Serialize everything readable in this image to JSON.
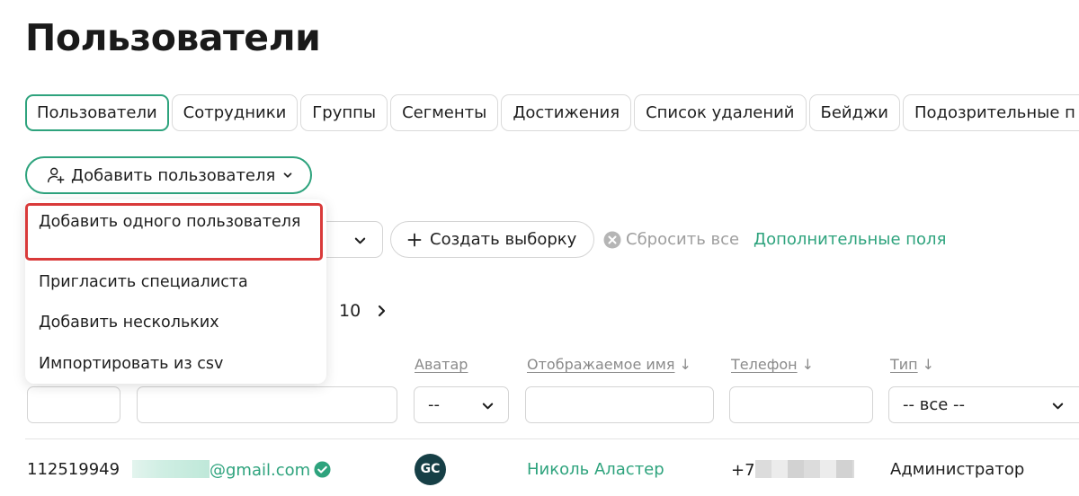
{
  "page": {
    "title": "Пользователи"
  },
  "tabs": [
    {
      "label": "Пользователи",
      "active": true
    },
    {
      "label": "Сотрудники"
    },
    {
      "label": "Группы"
    },
    {
      "label": "Сегменты"
    },
    {
      "label": "Достижения"
    },
    {
      "label": "Список удалений"
    },
    {
      "label": "Бейджи"
    },
    {
      "label": "Подозрительные п"
    }
  ],
  "toolbar": {
    "add_user_label": "Добавить пользователя",
    "add_user_icon": "user-plus-icon",
    "menu": [
      "Добавить одного пользователя",
      "Пригласить специалиста",
      "Добавить нескольких",
      "Импортировать из csv"
    ],
    "highlighted_menu_item": "Добавить одного пользователя"
  },
  "filters_bar": {
    "create_selection_label": "Создать выборку",
    "reset_label": "Сбросить все",
    "extra_fields_label": "Дополнительные поля"
  },
  "pagination": {
    "last_page": "10"
  },
  "table": {
    "columns": {
      "avatar": "Аватар",
      "display_name": "Отображаемое имя",
      "phone": "Телефон",
      "type": "Тип"
    },
    "sort_arrow": "↓",
    "filters": {
      "avatar_select": "--",
      "type_select": "-- все --"
    },
    "rows": [
      {
        "id": "112519949",
        "email_domain": "@gmail.com",
        "avatar_initials": "GC",
        "display_name": "Николь Аластер",
        "phone_prefix": "+7",
        "type": "Администратор"
      }
    ]
  },
  "colors": {
    "accent": "#2ea37d",
    "highlight_border": "#d93a3a",
    "avatar_bg": "#163f46",
    "muted_text": "#8a8a8a"
  }
}
